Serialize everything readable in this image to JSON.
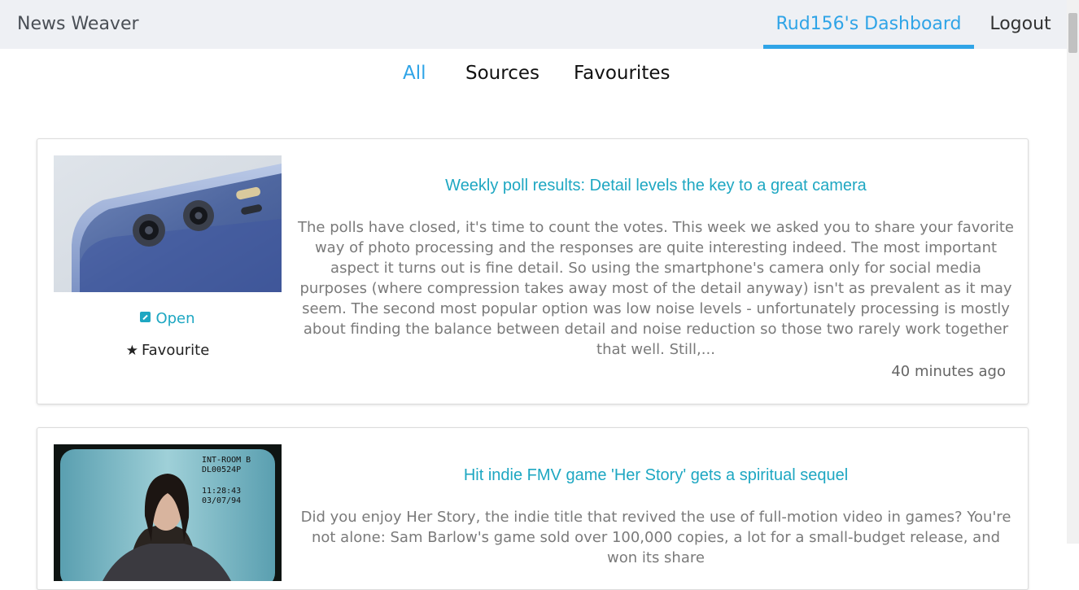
{
  "navbar": {
    "brand": "News Weaver",
    "dashboard_label": "Rud156's Dashboard",
    "logout_label": "Logout"
  },
  "tabs": [
    {
      "label": "All",
      "active": true
    },
    {
      "label": "Sources",
      "active": false
    },
    {
      "label": "Favourites",
      "active": false
    }
  ],
  "articles": [
    {
      "title": "Weekly poll results: Detail levels the key to a great camera",
      "description": "The polls have closed, it's time to count the votes. This week we asked you to share your favorite way of photo processing and the responses are quite interesting indeed. The most important aspect it turns out is fine detail. So using the smartphone's camera only for social media purposes (where compression takes away most of the detail anyway) isn't as prevalent as it may seem. The second most popular option was low noise levels - unfortunately processing is mostly about finding the balance between detail and noise reduction so those two rarely work together that well. Still,...",
      "open_label": "Open",
      "favourite_label": "Favourite",
      "timestamp": "40 minutes ago"
    },
    {
      "title": "Hit indie FMV game 'Her Story' gets a spiritual sequel",
      "description": "Did you enjoy Her Story, the indie title that revived the use of full-motion video in games? You're not alone: Sam Barlow's game sold over 100,000 copies, a lot for a small-budget release, and won its share",
      "thumb_overlay": [
        "INT-ROOM B",
        "DL00524P",
        "11:28:43",
        "03/07/94"
      ]
    }
  ],
  "colors": {
    "accent": "#2fa4e7",
    "title_teal": "#1ea7c2",
    "navbar_bg": "#eef0f4"
  }
}
